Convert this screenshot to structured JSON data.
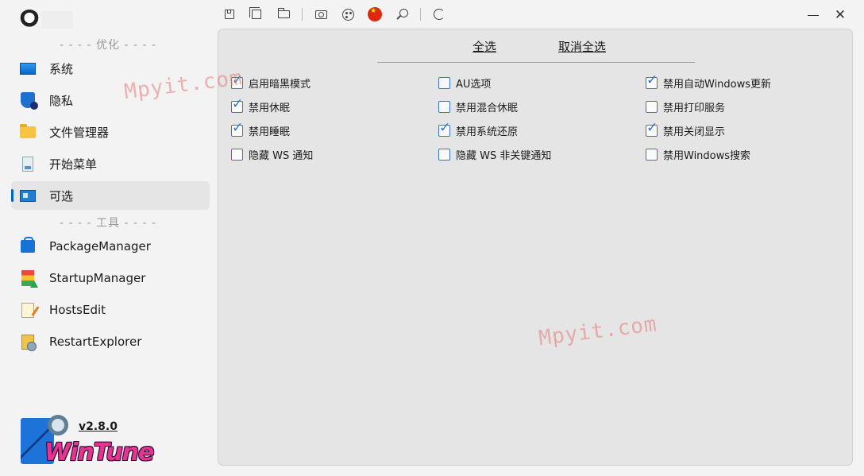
{
  "sidebar": {
    "section_optimize": "- - - - 优化 - - - -",
    "section_tools": "- - - - 工具 - - - -",
    "nav": [
      {
        "label": "系统"
      },
      {
        "label": "隐私"
      },
      {
        "label": "文件管理器"
      },
      {
        "label": "开始菜单"
      },
      {
        "label": "可选"
      }
    ],
    "tools": [
      {
        "label": "PackageManager"
      },
      {
        "label": "StartupManager"
      },
      {
        "label": "HostsEdit"
      },
      {
        "label": "RestartExplorer"
      }
    ],
    "version": "v2.8.0",
    "logo_text": "WinTune"
  },
  "main": {
    "select_all": "全选",
    "deselect_all": "取消全选",
    "options": [
      {
        "label": "启用暗黑模式",
        "checked": true
      },
      {
        "label": "AU选项",
        "checked": false
      },
      {
        "label": "禁用自动Windows更新",
        "checked": true
      },
      {
        "label": "禁用休眠",
        "checked": true
      },
      {
        "label": "禁用混合休眠",
        "checked": false
      },
      {
        "label": "禁用打印服务",
        "checked": false
      },
      {
        "label": "禁用睡眠",
        "checked": true
      },
      {
        "label": "禁用系统还原",
        "checked": true
      },
      {
        "label": "禁用关闭显示",
        "checked": true
      },
      {
        "label": "隐藏 WS 通知",
        "checked": false
      },
      {
        "label": "隐藏 WS 非关键通知",
        "checked": false
      },
      {
        "label": "禁用Windows搜索",
        "checked": false
      }
    ]
  },
  "watermark": "Mpyit.com",
  "colors": {
    "accent": "#0067c0",
    "checkbox": "#3a72c4",
    "logo": "#e8348e"
  }
}
